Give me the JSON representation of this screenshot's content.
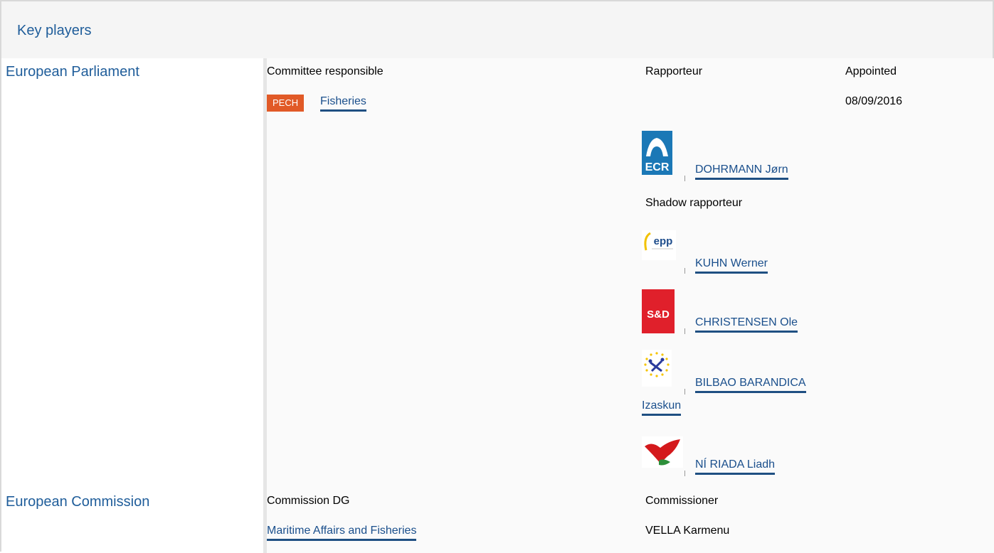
{
  "header": {
    "title": "Key players"
  },
  "parliament": {
    "title": "European Parliament",
    "committee_label": "Committee responsible",
    "rapporteur_label": "Rapporteur",
    "appointed_label": "Appointed",
    "committee_badge": "PECH",
    "committee_name": "Fisheries",
    "appointed_date": "08/09/2016",
    "rapporteur": {
      "group_logo": "ECR",
      "name": "DOHRMANN Jørn"
    },
    "shadow_label": "Shadow rapporteur",
    "shadows": [
      {
        "group_logo": "epp",
        "name": "KUHN Werner"
      },
      {
        "group_logo": "S&D",
        "name": "CHRISTENSEN Ole"
      },
      {
        "group_logo": "ALDE-stars",
        "name_line1": "BILBAO BARANDICA",
        "name_line2": "Izaskun"
      },
      {
        "group_logo": "GUE/NGL-flag",
        "name": "NÍ RIADA Liadh"
      }
    ]
  },
  "commission": {
    "title": "European Commission",
    "dg_label": "Commission DG",
    "commissioner_label": "Commissioner",
    "dg_name": "Maritime Affairs and Fisheries",
    "commissioner_name": "VELLA Karmenu"
  },
  "colors": {
    "link": "#1a4f8c",
    "heading": "#1f5d9a",
    "badge": "#e15a27"
  }
}
